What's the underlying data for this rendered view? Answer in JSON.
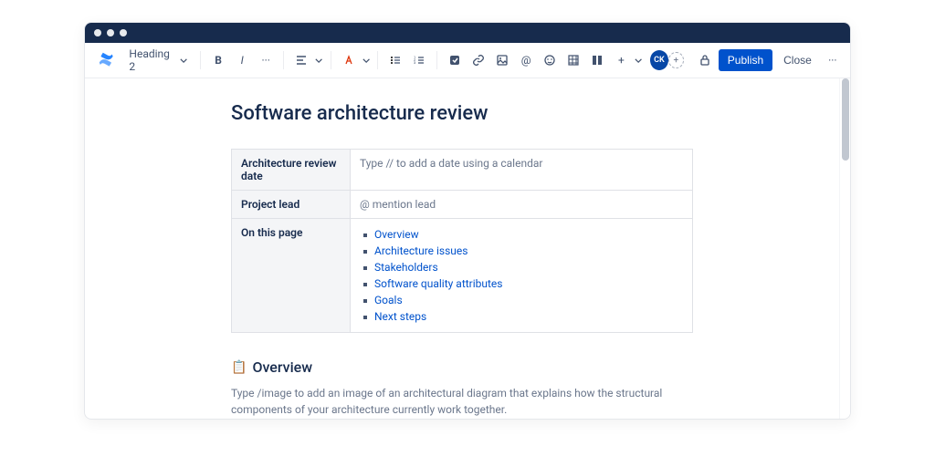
{
  "avatar_initials": "CK",
  "toolbar": {
    "style_label": "Heading 2",
    "publish_label": "Publish",
    "close_label": "Close"
  },
  "page": {
    "title": "Software architecture review",
    "meta": {
      "row0_label": "Architecture review date",
      "row0_value": "Type // to add a date using a calendar",
      "row1_label": "Project lead",
      "row1_value": "@ mention lead",
      "row2_label": "On this page"
    },
    "toc": {
      "i0": "Overview",
      "i1": "Architecture issues",
      "i2": "Stakeholders",
      "i3": "Software quality attributes",
      "i4": "Goals",
      "i5": "Next steps"
    },
    "overview": {
      "emoji": "📋",
      "heading": "Overview",
      "placeholder": "Type /image to add an image of an architectural diagram that explains how the structural components of your architecture currently work together."
    }
  }
}
